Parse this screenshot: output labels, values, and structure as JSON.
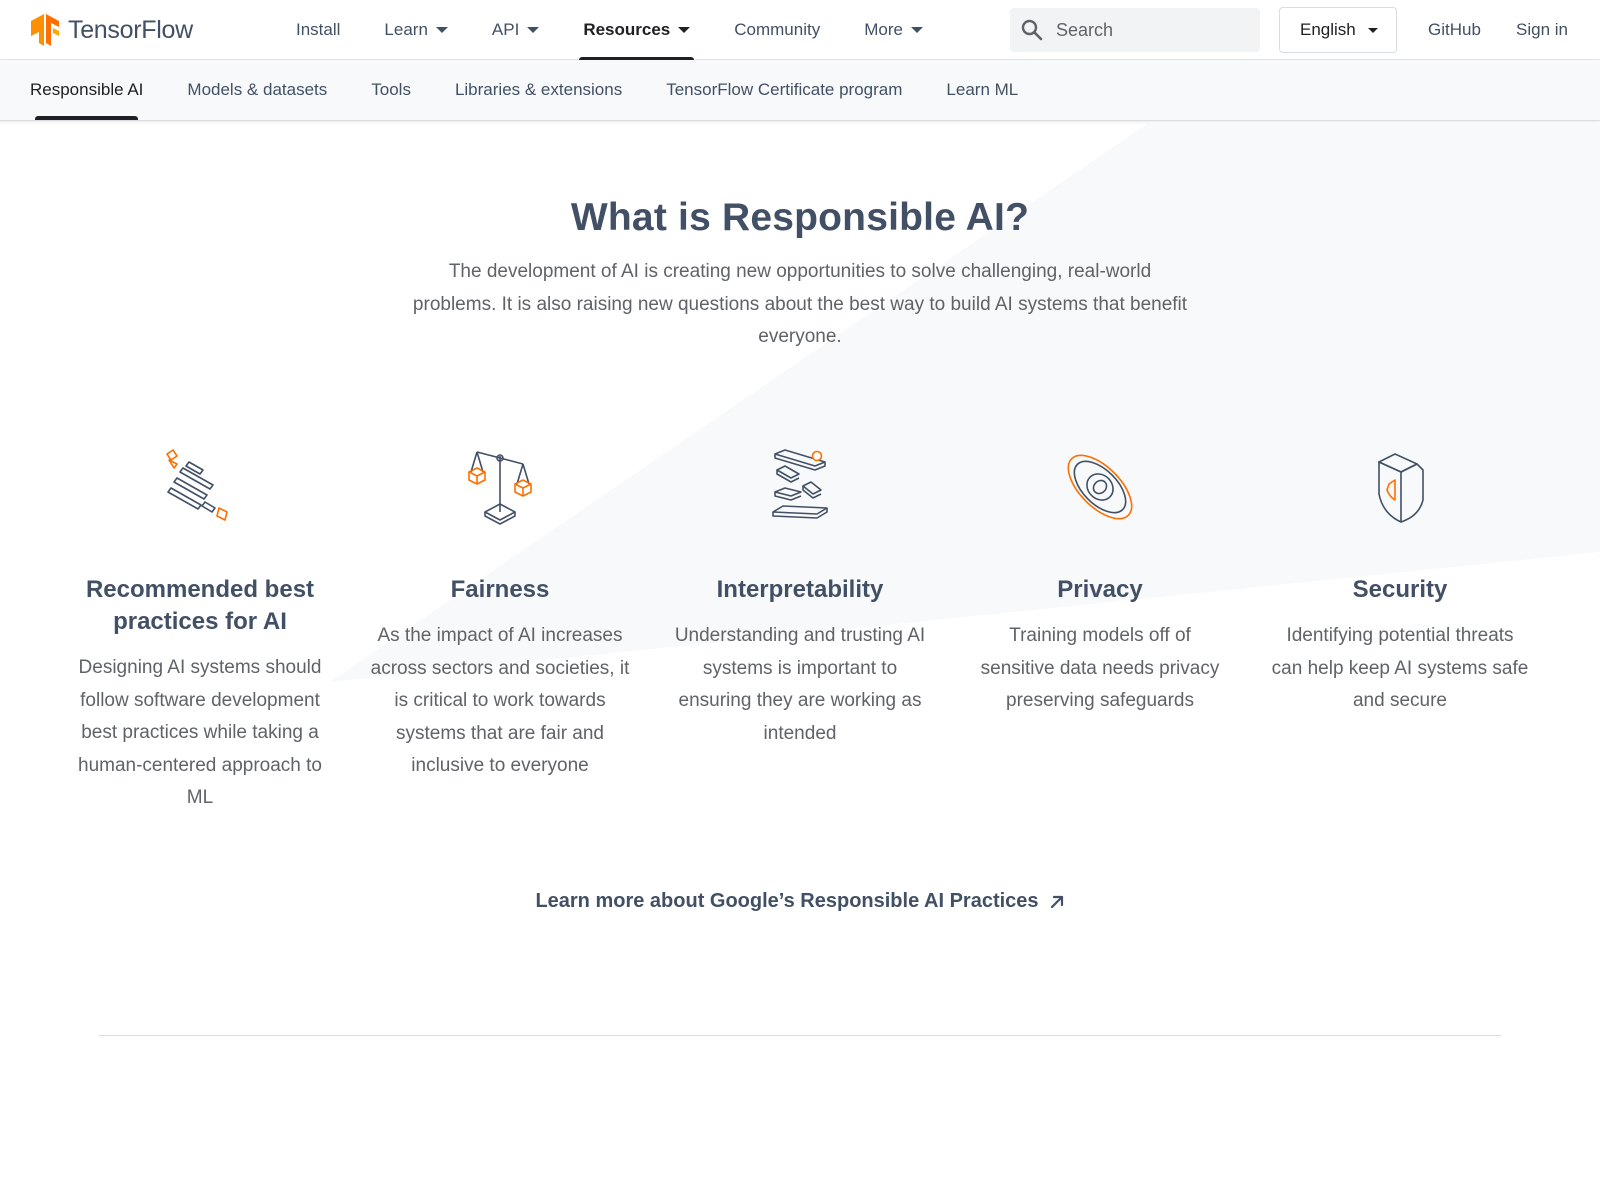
{
  "header": {
    "brand": "TensorFlow",
    "nav": [
      {
        "label": "Install",
        "has_menu": false
      },
      {
        "label": "Learn",
        "has_menu": true
      },
      {
        "label": "API",
        "has_menu": true
      },
      {
        "label": "Resources",
        "has_menu": true,
        "active": true
      },
      {
        "label": "Community",
        "has_menu": false
      },
      {
        "label": "More",
        "has_menu": true
      }
    ],
    "search_placeholder": "Search",
    "language": "English",
    "github_label": "GitHub",
    "signin_label": "Sign in"
  },
  "subnav": {
    "items": [
      {
        "label": "Responsible AI",
        "active": true
      },
      {
        "label": "Models & datasets"
      },
      {
        "label": "Tools"
      },
      {
        "label": "Libraries & extensions"
      },
      {
        "label": "TensorFlow Certificate program"
      },
      {
        "label": "Learn ML"
      }
    ]
  },
  "main": {
    "title": "What is Responsible AI?",
    "intro": "The development of AI is creating new opportunities to solve challenging, real-world problems. It is also raising new questions about the best way to build AI systems that benefit everyone.",
    "cards": [
      {
        "icon": "best-practices-icon",
        "title": "Recommended best practices for AI",
        "description": "Designing AI systems should follow software development best practices while taking a human-centered approach to ML"
      },
      {
        "icon": "fairness-scale-icon",
        "title": "Fairness",
        "description": "As the impact of AI increases across sectors and societies, it is critical to work towards systems that are fair and inclusive to everyone"
      },
      {
        "icon": "interpretability-icon",
        "title": "Interpretability",
        "description": "Understanding and trusting AI systems is important to ensuring they are working as intended"
      },
      {
        "icon": "privacy-eye-icon",
        "title": "Privacy",
        "description": "Training models off of sensitive data needs privacy preserving safeguards"
      },
      {
        "icon": "security-shield-icon",
        "title": "Security",
        "description": "Identifying potential threats can help keep AI systems safe and secure"
      }
    ],
    "learn_more": "Learn more about Google’s Responsible AI Practices"
  },
  "colors": {
    "heading": "#425066",
    "body_text": "#5f6368",
    "accent_orange": "#ff6f00",
    "subnav_bg": "#f8f9fa"
  }
}
